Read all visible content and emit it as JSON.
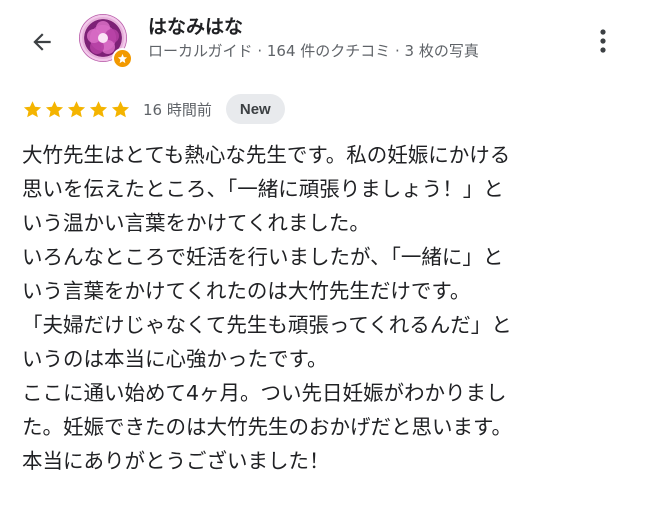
{
  "header": {
    "back_icon": "arrow-left-icon",
    "user_name": "はなみはな",
    "user_meta": "ローカルガイド · 164 件のクチコミ · 3 枚の写真",
    "more_icon": "more-vert-icon"
  },
  "rating": {
    "stars": 5,
    "max_stars": 5,
    "time": "16 時間前",
    "new_label": "New",
    "star_color": "#f4b400"
  },
  "review": {
    "lines": [
      "大竹先生はとても熱心な先生です。私の妊娠にかける",
      "思いを伝えたところ、「一緒に頑張りましょう！」と",
      "いう温かい言葉をかけてくれました。",
      "いろんなところで妊活を行いましたが、「一緒に」と",
      "いう言葉をかけてくれたのは大竹先生だけです。",
      "「夫婦だけじゃなくて先生も頑張ってくれるんだ」と",
      "いうのは本当に心強かったです。",
      "ここに通い始めて4ヶ月。つい先日妊娠がわかりまし",
      "た。妊娠できたのは大竹先生のおかげだと思います。",
      "本当にありがとうございました！"
    ]
  }
}
